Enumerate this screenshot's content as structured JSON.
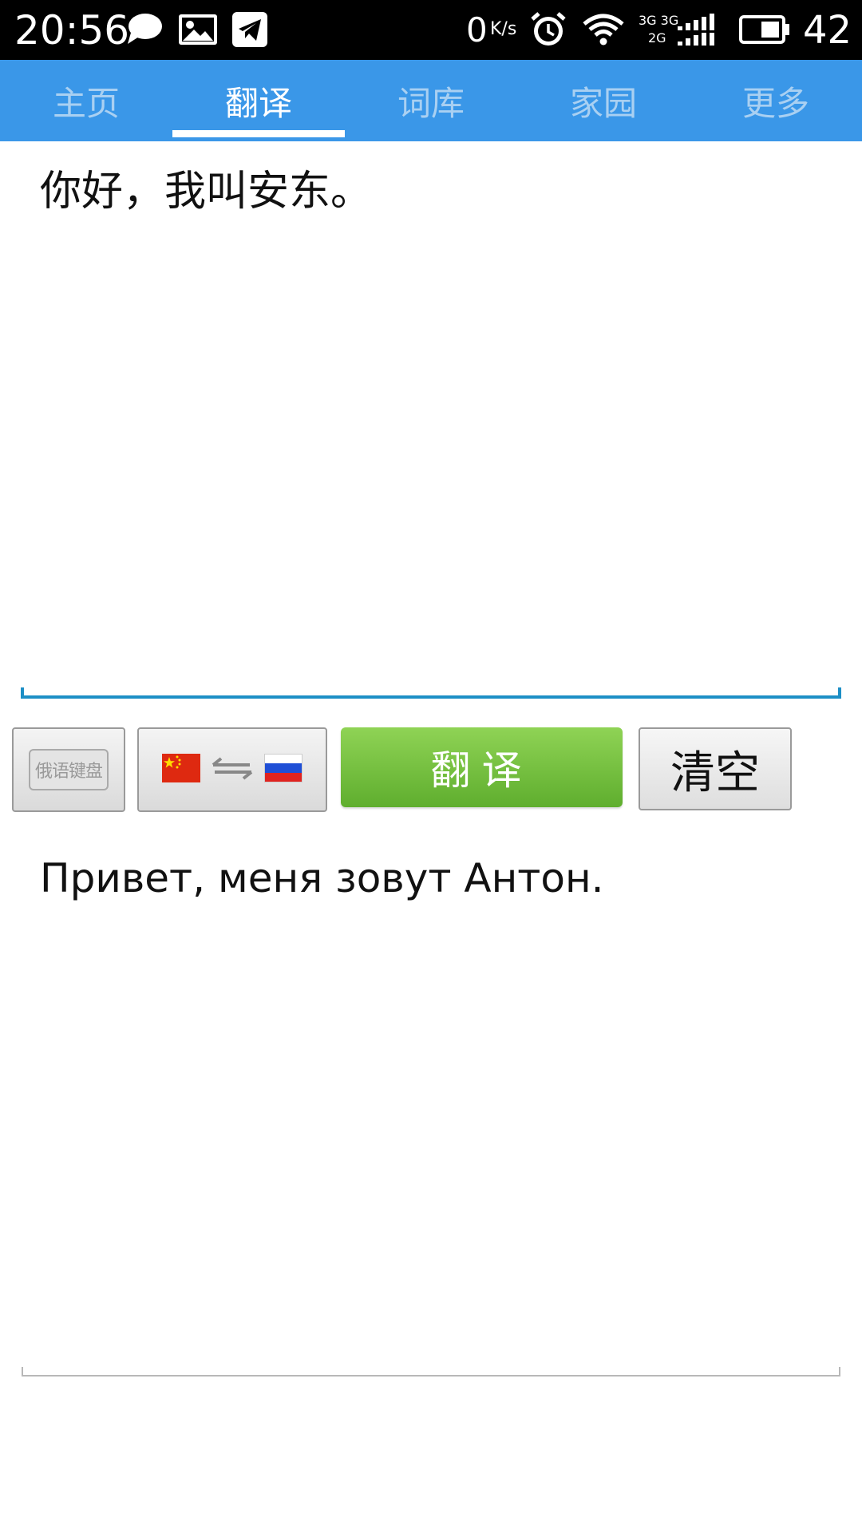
{
  "status_bar": {
    "time": "20:56",
    "net_speed_value": "0",
    "net_speed_unit": "K/s",
    "network_top": "3G 3G",
    "network_bottom": "2G",
    "battery_level": "42",
    "icons": [
      "chat-bubble-icon",
      "gallery-icon",
      "telegram-icon",
      "alarm-icon",
      "wifi-icon",
      "signal-icon",
      "battery-icon"
    ]
  },
  "tabs": [
    {
      "label": "主页",
      "active": false
    },
    {
      "label": "翻译",
      "active": true
    },
    {
      "label": "词库",
      "active": false
    },
    {
      "label": "家园",
      "active": false
    },
    {
      "label": "更多",
      "active": false
    }
  ],
  "input": {
    "value": "你好，我叫安东。"
  },
  "buttons": {
    "keyboard_label": "俄语键盘",
    "swap_from": "chinese-flag-icon",
    "swap_to": "russian-flag-icon",
    "translate_label": "翻译",
    "clear_label": "清空"
  },
  "output": {
    "text": "Привет, меня зовут Антон."
  },
  "colors": {
    "tab_bar": "#3a97e8",
    "tab_active": "#ffffff",
    "tab_inactive": "#a9d0f2",
    "translate_button": "#6cbf3a",
    "input_underline": "#1d8fc6"
  }
}
